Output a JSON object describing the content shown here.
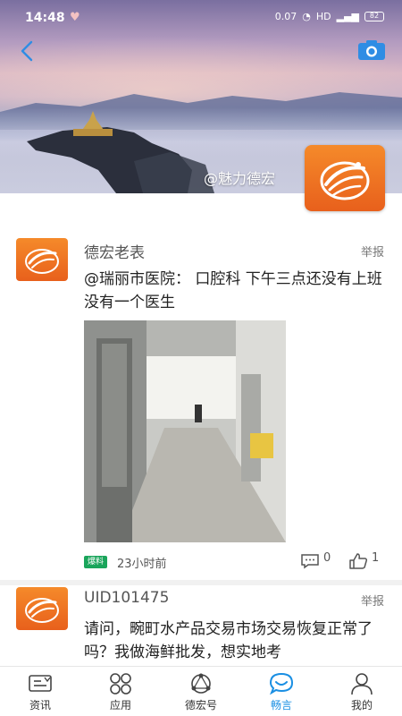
{
  "status_bar": {
    "time": "14:48",
    "heart_icon": "heart-icon",
    "network": "0.07",
    "hd_label": "HD",
    "battery": "82"
  },
  "header": {
    "back_icon": "chevron-left-icon",
    "camera_icon": "camera-icon",
    "watermark": "@魅力德宏",
    "accent_color": "#1a8fe3",
    "logo_color": "#f07a24"
  },
  "posts": [
    {
      "author": "德宏老表",
      "report_label": "举报",
      "text": "@瑞丽市医院： 口腔科 下午三点还没有上班 没有一个医生",
      "tag": "爆料",
      "time": "23小时前",
      "comments": "0",
      "likes": "1"
    },
    {
      "author": "UID101475",
      "report_label": "举报",
      "text": "请问，畹町水产品交易市场交易恢复正常了吗？我做海鲜批发，想实地考"
    }
  ],
  "tabbar": {
    "tabs": [
      {
        "label": "资讯",
        "icon": "news-icon",
        "active": false
      },
      {
        "label": "应用",
        "icon": "apps-icon",
        "active": false
      },
      {
        "label": "德宏号",
        "icon": "network-icon",
        "active": false
      },
      {
        "label": "畅言",
        "icon": "chat-icon",
        "active": true
      },
      {
        "label": "我的",
        "icon": "profile-icon",
        "active": false
      }
    ]
  }
}
